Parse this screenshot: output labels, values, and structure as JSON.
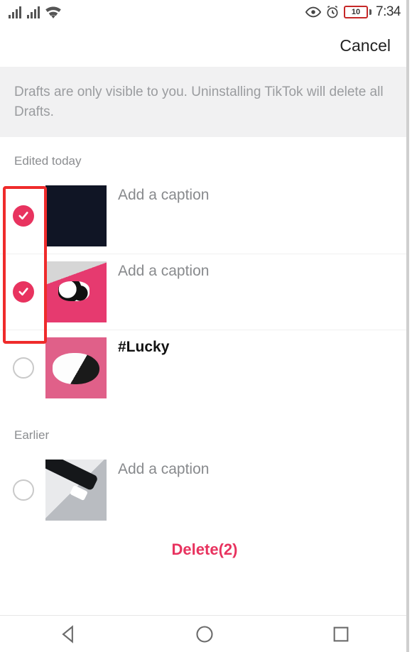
{
  "status": {
    "battery_text": "10",
    "time": "7:34"
  },
  "header": {
    "cancel": "Cancel"
  },
  "banner": "Drafts are only visible to you. Uninstalling TikTok will delete all Drafts.",
  "sections": {
    "today_title": "Edited today",
    "earlier_title": "Earlier"
  },
  "drafts": {
    "today": [
      {
        "caption": "Add a caption",
        "bold": false,
        "selected": true,
        "thumb": "dark"
      },
      {
        "caption": "Add a caption",
        "bold": false,
        "selected": true,
        "thumb": "pink"
      },
      {
        "caption": "#Lucky",
        "bold": true,
        "selected": false,
        "thumb": "pet"
      }
    ],
    "earlier": [
      {
        "caption": "Add a caption",
        "bold": false,
        "selected": false,
        "thumb": "cable"
      }
    ]
  },
  "delete_label": "Delete(2)"
}
